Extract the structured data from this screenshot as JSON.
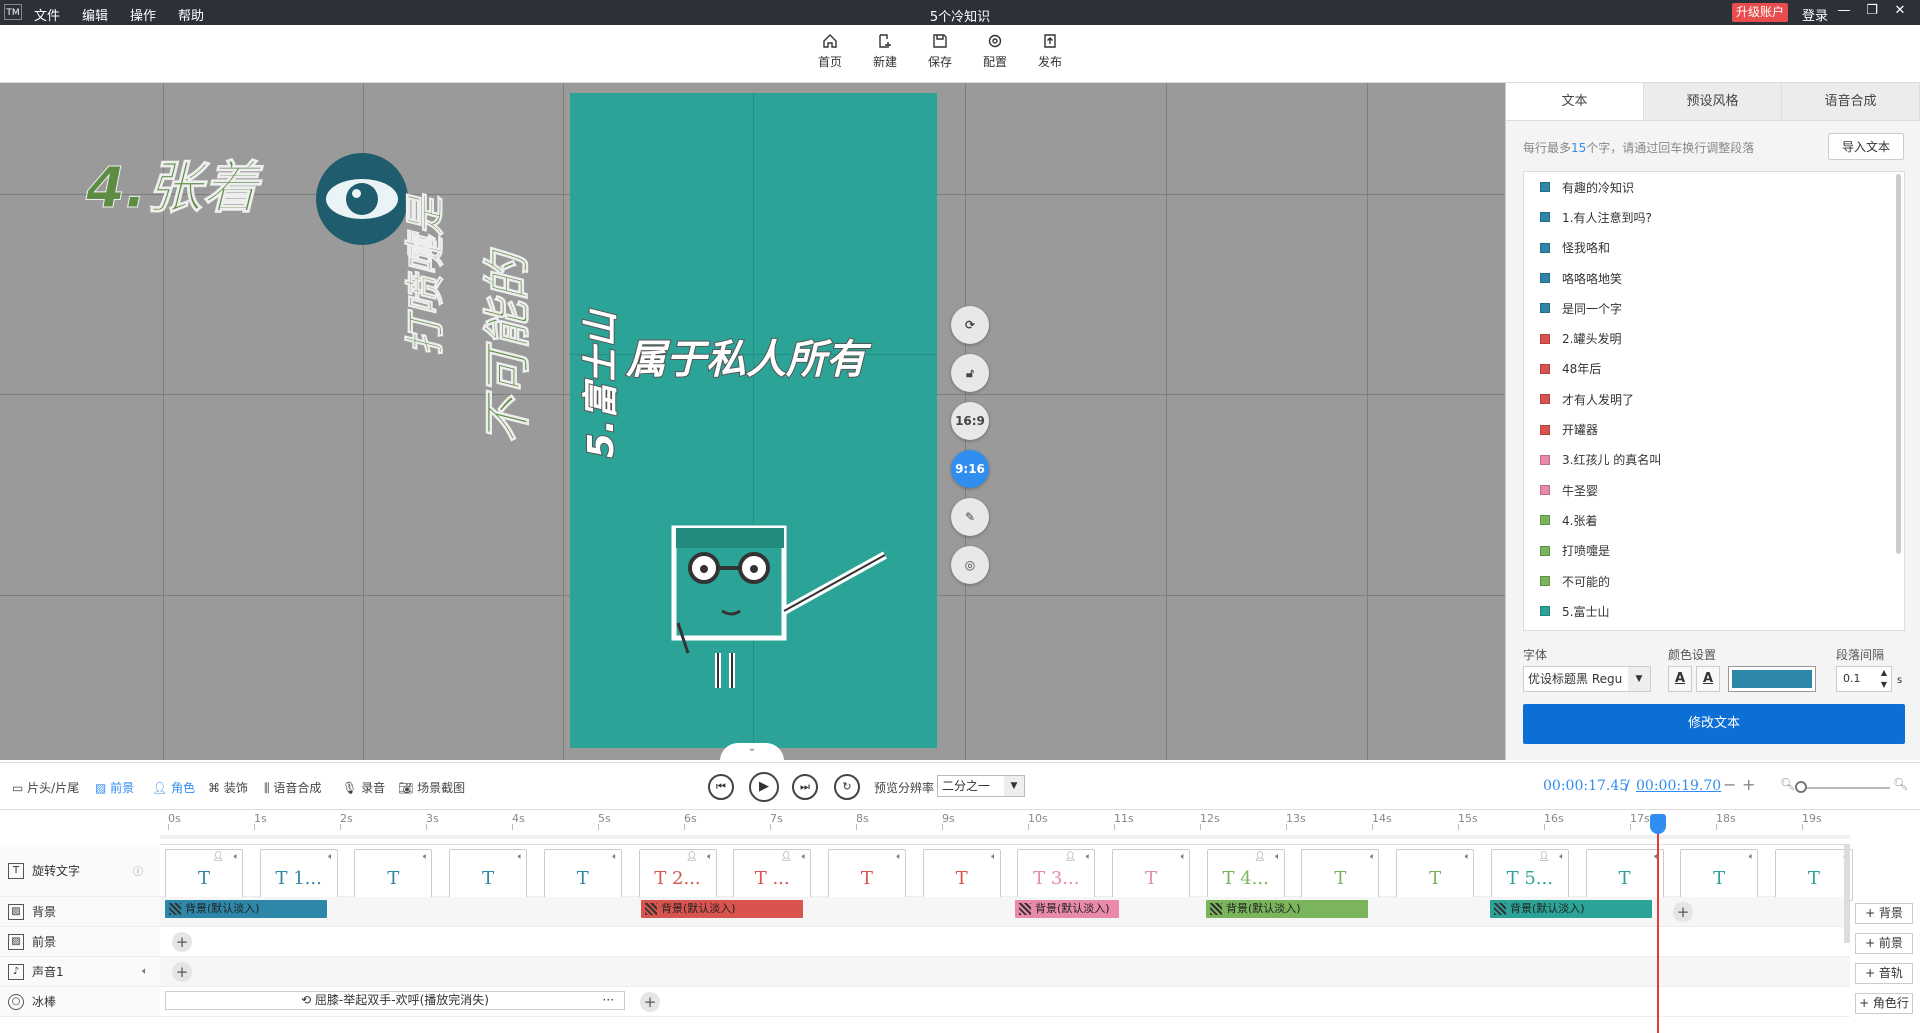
{
  "app": {
    "logo": "TM",
    "title": "5个冷知识",
    "menu": [
      "文件",
      "编辑",
      "操作",
      "帮助"
    ],
    "upgrade": "升级账户",
    "login": "登录"
  },
  "toolbar": {
    "home": "首页",
    "new": "新建",
    "save": "保存",
    "config": "配置",
    "publish": "发布"
  },
  "canvas": {
    "text_4": "4.张着",
    "text_da": "打喷嚏是",
    "text_buke": "不可能的",
    "text_fuji": "5.富士山",
    "text_main": "属于私人所有",
    "ratio_169": "16:9",
    "ratio_916": "9:16",
    "bg_color": "#2ba497"
  },
  "panel": {
    "tabs": [
      "文本",
      "预设风格",
      "语音合成"
    ],
    "hint_pre": "每行最多",
    "hint_num": "15",
    "hint_post": "个字，请通过回车换行调整段落",
    "import": "导入文本",
    "items": [
      {
        "text": "有趣的冷知识",
        "color": "#2e87a8"
      },
      {
        "text": "1.有人注意到吗?",
        "color": "#2e87a8"
      },
      {
        "text": "怪我咯和",
        "color": "#2e87a8"
      },
      {
        "text": "咯咯咯地笑",
        "color": "#2e87a8"
      },
      {
        "text": "是同一个字",
        "color": "#2e87a8"
      },
      {
        "text": "2.罐头发明",
        "color": "#d9534f"
      },
      {
        "text": "48年后",
        "color": "#d9534f"
      },
      {
        "text": "才有人发明了",
        "color": "#d9534f"
      },
      {
        "text": "开罐器",
        "color": "#d9534f"
      },
      {
        "text": "3.红孩儿 的真名叫",
        "color": "#e88aa8"
      },
      {
        "text": "牛圣婴",
        "color": "#e88aa8"
      },
      {
        "text": "4.张着",
        "color": "#7ab55c"
      },
      {
        "text": "打喷嚏是",
        "color": "#7ab55c"
      },
      {
        "text": "不可能的",
        "color": "#7ab55c"
      },
      {
        "text": "5.富士山",
        "color": "#2ba497"
      }
    ],
    "font_label": "字体",
    "color_label": "颜色设置",
    "spacing_label": "段落间隔",
    "font_value": "优设标题黑 Regu",
    "spacing_value": "0.1",
    "spacing_unit": "s",
    "color_value": "#2e87a8",
    "modify": "修改文本"
  },
  "controls": {
    "items": [
      "片头/片尾",
      "前景",
      "角色",
      "装饰",
      "语音合成",
      "录音",
      "场景截图"
    ],
    "res_label": "预览分辨率",
    "res_value": "二分之一",
    "time_current": "00:00:17.45",
    "time_sep": "/",
    "time_total": "00:00:19.70"
  },
  "timeline": {
    "ticks": [
      "0s",
      "1s",
      "2s",
      "3s",
      "4s",
      "5s",
      "6s",
      "7s",
      "8s",
      "9s",
      "10s",
      "11s",
      "12s",
      "13s",
      "14s",
      "15s",
      "16s",
      "17s",
      "18s",
      "19s"
    ],
    "rows": [
      "旋转文字",
      "背景",
      "前景",
      "声音1",
      "冰棒"
    ],
    "text_clips": [
      {
        "label": "T",
        "color": "#2e87a8",
        "user": true
      },
      {
        "label": "T 1...",
        "color": "#2e87a8",
        "user": false
      },
      {
        "label": "T",
        "color": "#2e87a8",
        "user": false
      },
      {
        "label": "T",
        "color": "#2e87a8",
        "user": false
      },
      {
        "label": "T",
        "color": "#2e87a8",
        "user": false
      },
      {
        "label": "T 2...",
        "color": "#d9534f",
        "user": true
      },
      {
        "label": "T ...",
        "color": "#d9534f",
        "user": true
      },
      {
        "label": "T",
        "color": "#d9534f",
        "user": false
      },
      {
        "label": "T",
        "color": "#d9534f",
        "user": false
      },
      {
        "label": "T 3...",
        "color": "#e88aa8",
        "user": true
      },
      {
        "label": "T",
        "color": "#e88aa8",
        "user": false
      },
      {
        "label": "T 4...",
        "color": "#7ab55c",
        "user": true
      },
      {
        "label": "T",
        "color": "#7ab55c",
        "user": false
      },
      {
        "label": "T",
        "color": "#7ab55c",
        "user": false
      },
      {
        "label": "T 5...",
        "color": "#2ba497",
        "user": true
      },
      {
        "label": "T",
        "color": "#2ba497",
        "user": false
      },
      {
        "label": "T",
        "color": "#2ba497",
        "user": false
      },
      {
        "label": "T",
        "color": "#2ba497",
        "user": false
      }
    ],
    "bg_clip_label": "背景(默认淡入)",
    "bg_colors": [
      "#2e87a8",
      "#d9534f",
      "#e88aa8",
      "#7ab55c",
      "#2ba497"
    ],
    "action_clip": "屈膝-举起双手-欢呼(播放完消失)",
    "add_bg": "+ 背景",
    "add_fg": "+ 前景",
    "add_audio": "+ 音轨",
    "add_role": "+ 角色行"
  }
}
